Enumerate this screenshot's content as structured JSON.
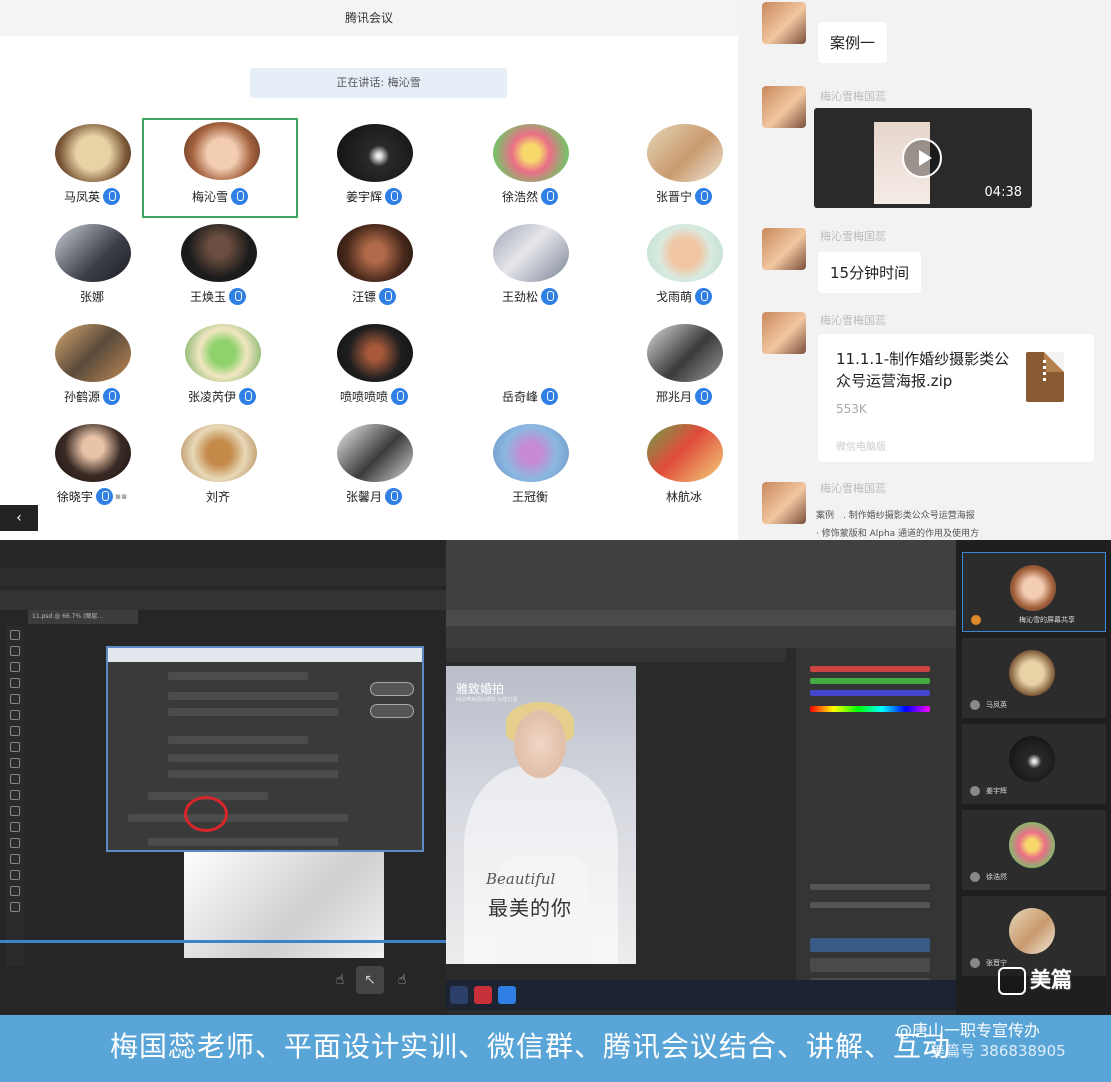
{
  "meeting": {
    "title": "腾讯会议",
    "speaking": "正在讲话: 梅沁雪",
    "participants": [
      {
        "name": "马凤英",
        "mic": true,
        "active": false
      },
      {
        "name": "梅沁雪",
        "mic": true,
        "active": true
      },
      {
        "name": "姜宇辉",
        "mic": true,
        "active": false
      },
      {
        "name": "徐浩然",
        "mic": true,
        "active": false
      },
      {
        "name": "张晋宁",
        "mic": true,
        "active": false
      },
      {
        "name": "张娜",
        "mic": false,
        "active": false
      },
      {
        "name": "王焕玉",
        "mic": true,
        "active": false
      },
      {
        "name": "汪镖",
        "mic": true,
        "active": false
      },
      {
        "name": "王劲松",
        "mic": true,
        "active": false
      },
      {
        "name": "戈雨萌",
        "mic": true,
        "active": false
      },
      {
        "name": "孙鹤源",
        "mic": true,
        "active": false
      },
      {
        "name": "张凌芮伊",
        "mic": true,
        "active": false
      },
      {
        "name": "喷喷喷喷",
        "mic": true,
        "active": false
      },
      {
        "name": "岳奇峰",
        "mic": true,
        "active": false
      },
      {
        "name": "邢兆月",
        "mic": true,
        "active": false
      },
      {
        "name": "徐晓宇",
        "mic": true,
        "active": false
      },
      {
        "name": "刘齐",
        "mic": false,
        "active": false
      },
      {
        "name": "张馨月",
        "mic": true,
        "active": false
      },
      {
        "name": "王冠衡",
        "mic": false,
        "active": false
      },
      {
        "name": "林航冰",
        "mic": false,
        "active": false
      }
    ],
    "back_arrow": "‹"
  },
  "chat": {
    "sender": "梅沁雪梅国蕊",
    "msg1": "案例一",
    "video_duration": "04:38",
    "msg3": "15分钟时间",
    "file_name": "11.1.1-制作婚纱摄影类公众号运营海报.zip",
    "file_size": "553K",
    "file_source": "微信电脑版",
    "last_line1": "案例　. 制作婚纱摄影类公众号运营海报",
    "last_line2": "· 修饰蒙版和 Alpha 通道的作用及使用方"
  },
  "share": {
    "ps_tab": "11.psd @ 66.7% (图层...",
    "poster_title": "雅致婚拍",
    "poster_sub": "纯洁唯美婚纱摄影 为您打造",
    "poster_en": "Beautiful",
    "poster_cn": "最美的你",
    "video_tiles": [
      {
        "name": "梅沁雪的屏幕共享"
      },
      {
        "name": "马凤英"
      },
      {
        "name": "姜宇辉"
      },
      {
        "name": "徐浩然"
      },
      {
        "name": "张晋宁"
      }
    ]
  },
  "watermark": "美篇",
  "banner": {
    "text": "梅国蕊老师、平面设计实训、微信群、腾讯会议结合、讲解、互动",
    "credit": "@唐山一职专宣传办",
    "phone": "美篇号 386838905"
  }
}
